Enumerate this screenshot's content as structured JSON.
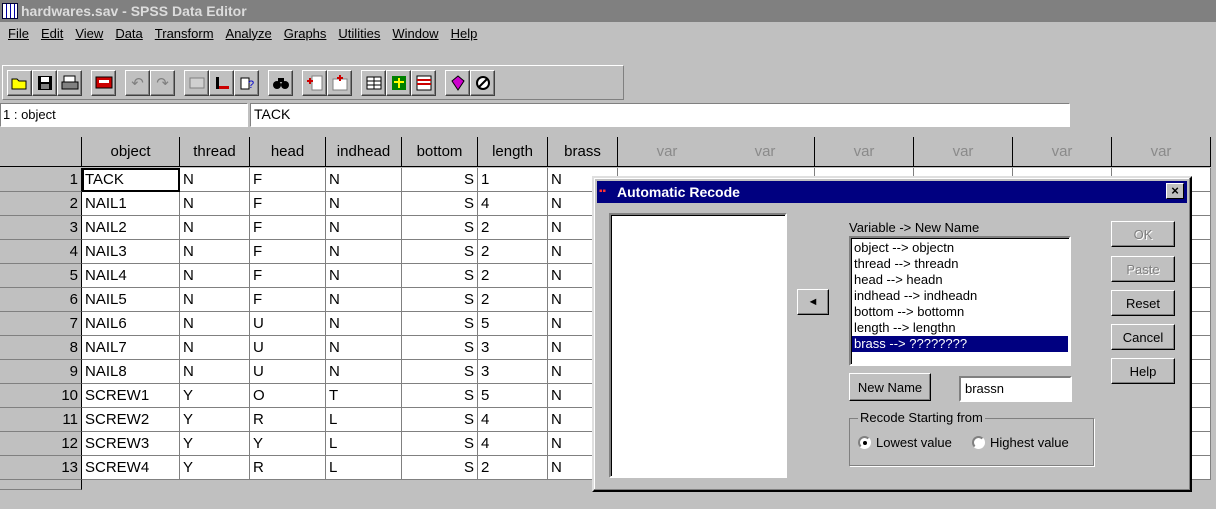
{
  "window": {
    "title": "hardwares.sav - SPSS Data Editor"
  },
  "menu": [
    "File",
    "Edit",
    "View",
    "Data",
    "Transform",
    "Analyze",
    "Graphs",
    "Utilities",
    "Window",
    "Help"
  ],
  "toolbar": {
    "icons": [
      "open-icon",
      "save-icon",
      "print-icon",
      "dialog-recall-icon",
      "undo-icon",
      "redo-icon",
      "goto-chart-icon",
      "goto-case-icon",
      "variables-icon",
      "find-icon",
      "insert-case-icon",
      "insert-variable-icon",
      "split-file-icon",
      "weight-cases-icon",
      "select-cases-icon",
      "value-labels-icon",
      "use-sets-icon"
    ]
  },
  "cell_editor": {
    "ref": "1 : object",
    "value": "TACK"
  },
  "grid": {
    "columns": [
      "object",
      "thread",
      "head",
      "indhead",
      "bottom",
      "length",
      "brass",
      "var",
      "var",
      "var",
      "var",
      "var",
      "var"
    ],
    "rows": [
      [
        "1",
        "TACK",
        "N",
        "F",
        "N",
        "S",
        "1",
        "N"
      ],
      [
        "2",
        "NAIL1",
        "N",
        "F",
        "N",
        "S",
        "4",
        "N"
      ],
      [
        "3",
        "NAIL2",
        "N",
        "F",
        "N",
        "S",
        "2",
        "N"
      ],
      [
        "4",
        "NAIL3",
        "N",
        "F",
        "N",
        "S",
        "2",
        "N"
      ],
      [
        "5",
        "NAIL4",
        "N",
        "F",
        "N",
        "S",
        "2",
        "N"
      ],
      [
        "6",
        "NAIL5",
        "N",
        "F",
        "N",
        "S",
        "2",
        "N"
      ],
      [
        "7",
        "NAIL6",
        "N",
        "U",
        "N",
        "S",
        "5",
        "N"
      ],
      [
        "8",
        "NAIL7",
        "N",
        "U",
        "N",
        "S",
        "3",
        "N"
      ],
      [
        "9",
        "NAIL8",
        "N",
        "U",
        "N",
        "S",
        "3",
        "N"
      ],
      [
        "10",
        "SCREW1",
        "Y",
        "O",
        "T",
        "S",
        "5",
        "N"
      ],
      [
        "11",
        "SCREW2",
        "Y",
        "R",
        "L",
        "S",
        "4",
        "N"
      ],
      [
        "12",
        "SCREW3",
        "Y",
        "Y",
        "L",
        "S",
        "4",
        "N"
      ],
      [
        "13",
        "SCREW4",
        "Y",
        "R",
        "L",
        "S",
        "2",
        "N"
      ]
    ]
  },
  "dialog": {
    "title": "Automatic Recode",
    "close": "×",
    "var_list_label": "Variable -> New Name",
    "mappings": [
      "object --> objectn",
      "thread --> threadn",
      "head --> headn",
      "indhead --> indheadn",
      "bottom --> bottomn",
      "length --> lengthn",
      "brass --> ????????"
    ],
    "selected_mapping": 6,
    "move_arrow": "◄",
    "buttons": {
      "ok": "OK",
      "paste": "Paste",
      "reset": "Reset",
      "cancel": "Cancel",
      "help": "Help"
    },
    "new_name_button": "New Name",
    "new_name_value": "brassn",
    "group_label": "Recode Starting from",
    "radio_lowest": "Lowest value",
    "radio_highest": "Highest value",
    "radio_selected": "lowest"
  }
}
